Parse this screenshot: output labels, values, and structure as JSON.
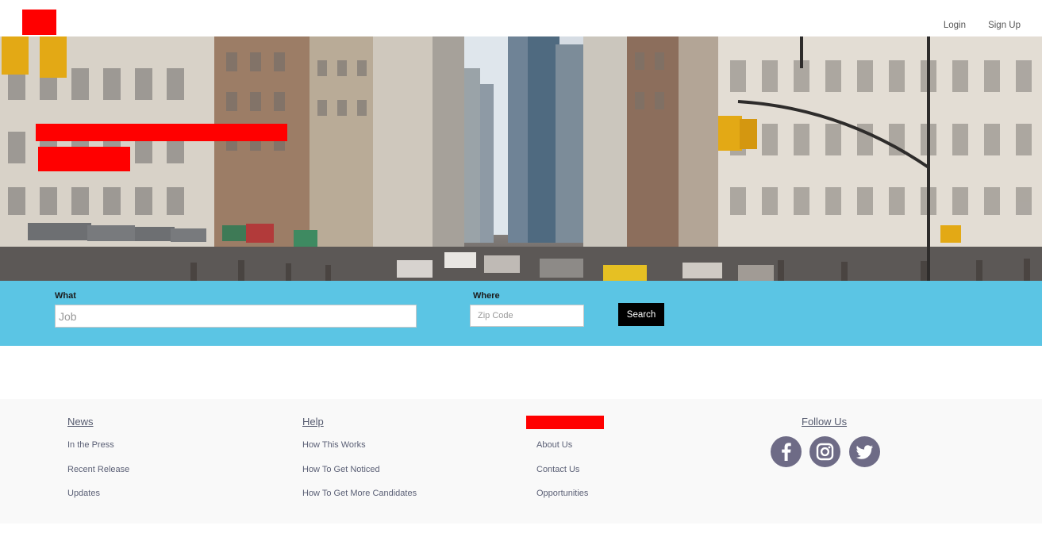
{
  "header": {
    "nav": {
      "login": "Login",
      "signup": "Sign Up"
    }
  },
  "search": {
    "what_label": "What",
    "what_placeholder": "Job",
    "where_label": "Where",
    "where_placeholder": "Zip Code",
    "button_label": "Search"
  },
  "footer": {
    "news": {
      "heading": "News",
      "links": [
        "In the Press",
        "Recent Release",
        "Updates"
      ]
    },
    "help": {
      "heading": "Help",
      "links": [
        "How This Works",
        "How To Get Noticed",
        "How To Get More Candidates"
      ]
    },
    "company": {
      "links": [
        "About Us",
        "Contact Us",
        "Opportunities"
      ]
    },
    "follow": {
      "heading": "Follow Us",
      "icons": [
        "facebook-icon",
        "instagram-icon",
        "twitter-icon"
      ]
    }
  },
  "colors": {
    "search_band": "#5bc5e4",
    "search_button": "#000000",
    "footer_bg": "#f9f9f9",
    "social_icon": "#6e6b86",
    "redaction": "#ff0000"
  }
}
